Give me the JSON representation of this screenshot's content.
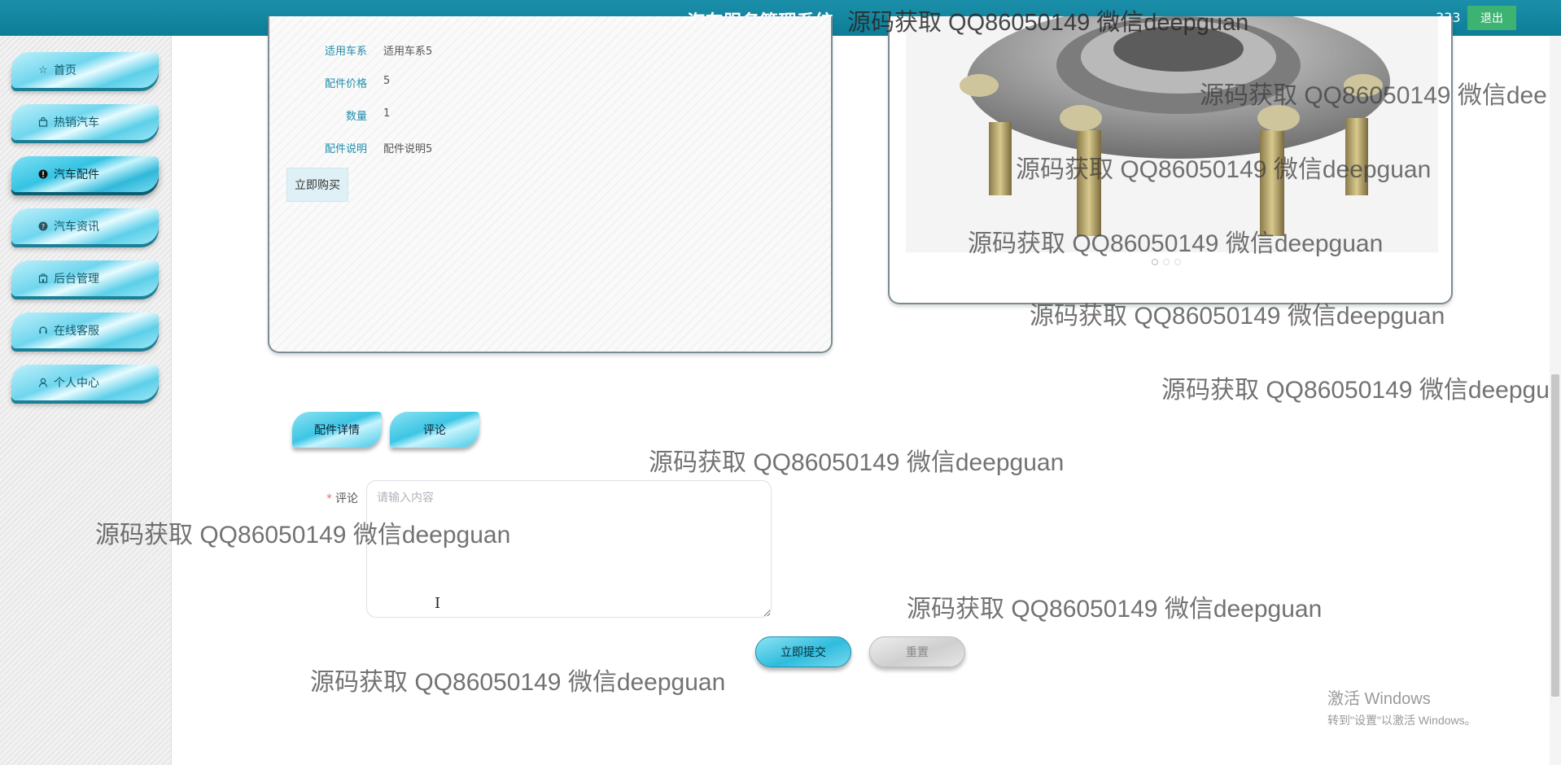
{
  "header": {
    "title": "汽车服务管理系统",
    "username": "333",
    "logout_label": "退出"
  },
  "sidebar": {
    "items": [
      {
        "label": "首页",
        "icon": "star-icon"
      },
      {
        "label": "热销汽车",
        "icon": "bag-icon"
      },
      {
        "label": "汽车配件",
        "icon": "info-icon",
        "active": true
      },
      {
        "label": "汽车资讯",
        "icon": "question-icon"
      },
      {
        "label": "后台管理",
        "icon": "building-icon"
      },
      {
        "label": "在线客服",
        "icon": "headset-icon"
      },
      {
        "label": "个人中心",
        "icon": "user-icon"
      }
    ]
  },
  "detail": {
    "fields": [
      {
        "label": "适用车系",
        "value": "适用车系5"
      },
      {
        "label": "配件价格",
        "value": "5"
      },
      {
        "label": "数量",
        "value": "1"
      },
      {
        "label": "配件说明",
        "value": "配件说明5"
      }
    ],
    "buy_label": "立即购买"
  },
  "carousel": {
    "image": "wheel-hub-bearing-photo",
    "dot_count": 3,
    "active_dot": 0
  },
  "tabs": [
    {
      "label": "配件详情"
    },
    {
      "label": "评论"
    }
  ],
  "comment_form": {
    "label": "评论",
    "required_mark": "*",
    "placeholder": "请输入内容",
    "value": "",
    "submit_label": "立即提交",
    "reset_label": "重置"
  },
  "watermark": {
    "text": "源码获取 QQ86050149 微信deepguan",
    "text_cut_1": "源码获取 QQ86050149 微信dee",
    "text_cut_2": "源码获取 QQ86050149 微信deepgu"
  },
  "os_overlay": {
    "line1": "激活 Windows",
    "line2": "转到\"设置\"以激活 Windows。"
  },
  "colors": {
    "header_bg": "#0d7d98",
    "logout_bg": "#3cb371",
    "accent": "#1f8dab"
  }
}
